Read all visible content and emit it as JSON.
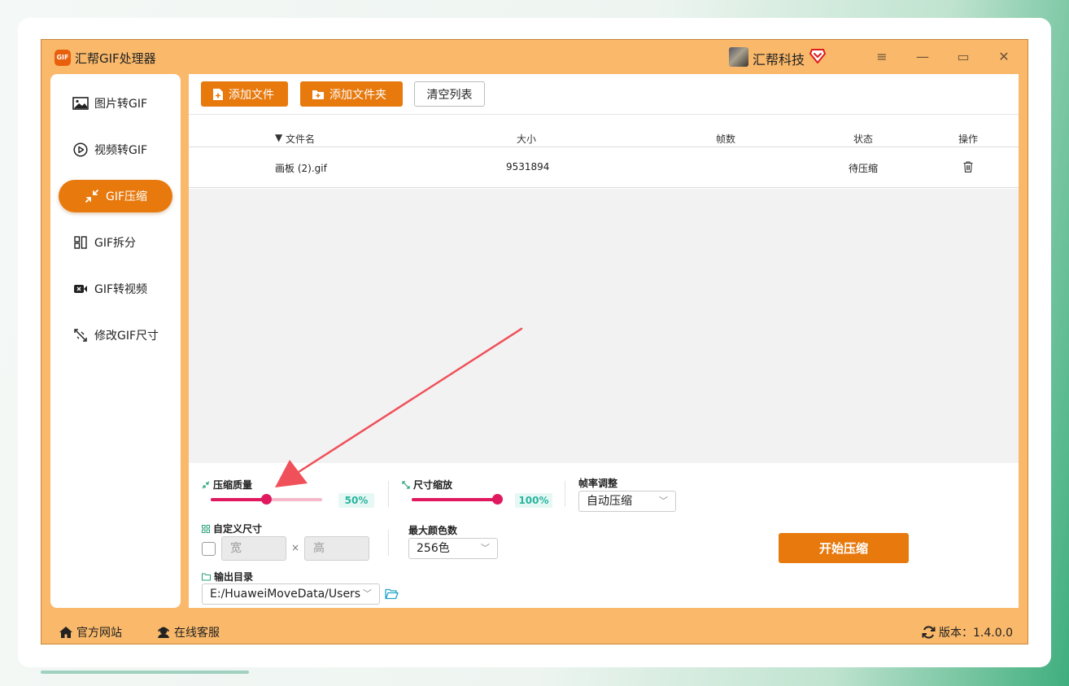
{
  "app": {
    "title": "汇帮GIF处理器",
    "logo_text": "GIF",
    "brand": "汇帮科技"
  },
  "window": {
    "menu_glyph": "≡",
    "minimize_glyph": "—",
    "maximize_glyph": "▭",
    "close_glyph": "✕"
  },
  "sidebar": {
    "items": [
      {
        "label": "图片转GIF",
        "active": false
      },
      {
        "label": "视频转GIF",
        "active": false
      },
      {
        "label": "GIF压缩",
        "active": true
      },
      {
        "label": "GIF拆分",
        "active": false
      },
      {
        "label": "GIF转视频",
        "active": false
      },
      {
        "label": "修改GIF尺寸",
        "active": false
      }
    ]
  },
  "toolbar": {
    "add_file": "添加文件",
    "add_folder": "添加文件夹",
    "clear_list": "清空列表"
  },
  "table": {
    "columns": {
      "name": "文件名",
      "size": "大小",
      "frames": "帧数",
      "status": "状态",
      "action": "操作"
    },
    "rows": [
      {
        "name": "画板 (2).gif",
        "size": "9531894",
        "frames": "",
        "status": "待压缩"
      }
    ]
  },
  "settings": {
    "quality": {
      "label": "压缩质量",
      "value": 50,
      "display": "50%"
    },
    "scale": {
      "label": "尺寸缩放",
      "value": 100,
      "display": "100%"
    },
    "framerate": {
      "label": "帧率调整",
      "selected": "自动压缩"
    },
    "custom_size": {
      "label": "自定义尺寸",
      "width_placeholder": "宽",
      "height_placeholder": "高",
      "times": "×"
    },
    "max_colors": {
      "label": "最大颜色数",
      "selected": "256色"
    },
    "output_dir": {
      "label": "输出目录",
      "value": "E:/HuaweiMoveData/Users"
    },
    "start_button": "开始压缩"
  },
  "footer": {
    "website": "官方网站",
    "support": "在线客服",
    "version": "版本：1.4.0.0"
  },
  "colors": {
    "accent": "#e7790d",
    "frame": "#f9b86a",
    "slider": "#e0195e",
    "percent": "#28b4a0",
    "arrow": "#f0505a"
  }
}
